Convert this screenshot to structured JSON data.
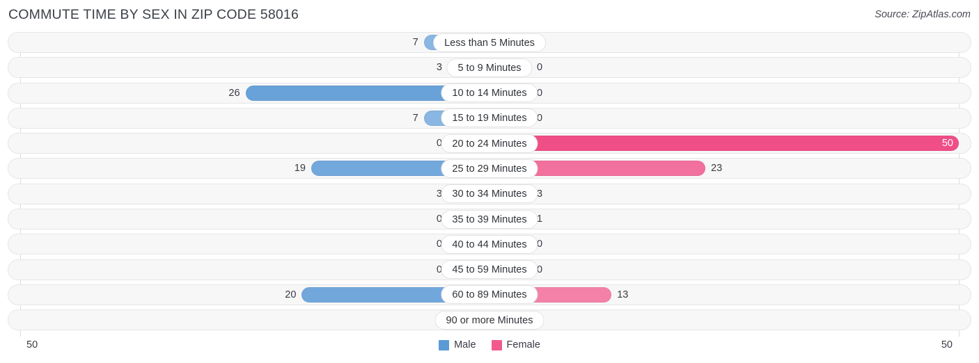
{
  "header": {
    "title": "COMMUTE TIME BY SEX IN ZIP CODE 58016",
    "source": "Source: ZipAtlas.com"
  },
  "legend": {
    "male_label": "Male",
    "female_label": "Female",
    "male_color": "#5b9bd5",
    "female_color": "#f2598c"
  },
  "axis": {
    "left_label": "50",
    "right_label": "50",
    "max": 50
  },
  "chart_data": {
    "type": "bar",
    "orientation": "horizontal-diverging",
    "title": "COMMUTE TIME BY SEX IN ZIP CODE 58016",
    "xlabel": "",
    "ylabel": "",
    "xlim": [
      50,
      50
    ],
    "grid": false,
    "legend_position": "bottom-center",
    "categories": [
      "Less than 5 Minutes",
      "5 to 9 Minutes",
      "10 to 14 Minutes",
      "15 to 19 Minutes",
      "20 to 24 Minutes",
      "25 to 29 Minutes",
      "30 to 34 Minutes",
      "35 to 39 Minutes",
      "40 to 44 Minutes",
      "45 to 59 Minutes",
      "60 to 89 Minutes",
      "90 or more Minutes"
    ],
    "series": [
      {
        "name": "Male",
        "side": "left",
        "values": [
          7,
          3,
          26,
          7,
          0,
          19,
          3,
          0,
          0,
          0,
          20,
          0
        ]
      },
      {
        "name": "Female",
        "side": "right",
        "values": [
          0,
          0,
          0,
          0,
          50,
          23,
          3,
          1,
          0,
          0,
          13,
          0
        ]
      }
    ]
  }
}
